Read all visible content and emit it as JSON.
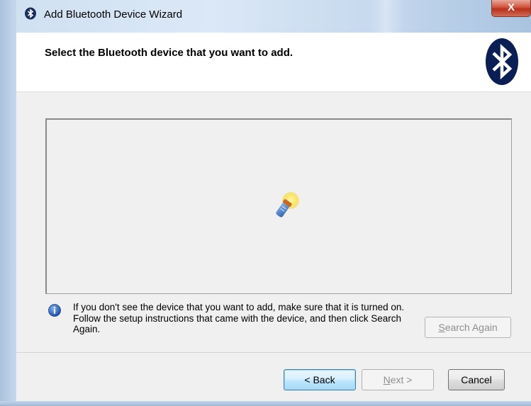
{
  "window": {
    "title": "Add Bluetooth Device Wizard",
    "close_label": "X"
  },
  "header": {
    "instruction": "Select the Bluetooth device that you want to add."
  },
  "device_list": {
    "state": "searching",
    "icon": "searching-flashlight-icon"
  },
  "info": {
    "icon": "info-icon",
    "text": "If you don't see the device that you want to add, make sure that it is turned on. Follow the setup instructions that came with the device, and then click Search Again."
  },
  "buttons": {
    "search_again": {
      "accel": "S",
      "rest": "earch Again"
    },
    "back": "< Back",
    "next": {
      "accel": "N",
      "rest": "ext >"
    },
    "cancel": "Cancel"
  },
  "colors": {
    "bluetooth_blue": "#0a3d91",
    "close_red": "#c8442d",
    "default_button": "#bee6fd"
  }
}
